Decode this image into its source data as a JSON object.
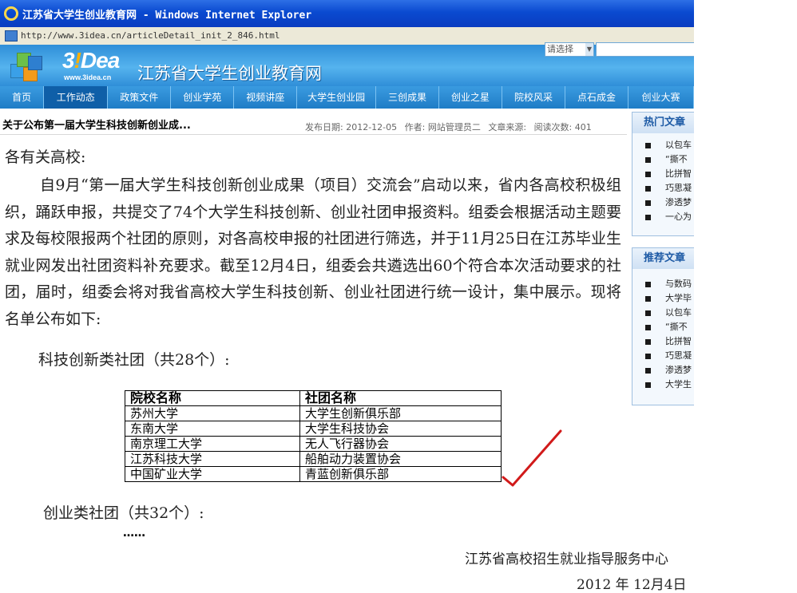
{
  "window": {
    "title": "江苏省大学生创业教育网 - Windows Internet Explorer"
  },
  "address": {
    "url": "http://www.3idea.cn/articleDetail_init_2_846.html"
  },
  "header": {
    "logo_text_a": "3",
    "logo_text_ex": "!",
    "logo_text_b": "Dea",
    "logo_url": "www.3idea.cn",
    "site_name": "江苏省大学生创业教育网",
    "select_label": "请选择"
  },
  "nav": {
    "items": [
      "首页",
      "工作动态",
      "政策文件",
      "创业学苑",
      "视频讲座",
      "大学生创业园",
      "三创成果",
      "创业之星",
      "院校风采",
      "点石成金",
      "创业大赛"
    ],
    "active": "工作动态"
  },
  "article": {
    "title": "关于公布第一届大学生科技创新创业成...",
    "meta_date": "发布日期: 2012-12-05",
    "meta_author": "作者: 网站管理员二",
    "meta_source": "文章来源:",
    "meta_views": "阅读次数: 401",
    "salutation": "各有关高校:",
    "paragraph": "自9月“第一届大学生科技创新创业成果（项目）交流会”启动以来，省内各高校积极组织，踊跃申报，共提交了74个大学生科技创新、创业社团申报资料。组委会根据活动主题要求及每校限报两个社团的原则，对各高校申报的社团进行筛选，并于11月25日在江苏毕业生就业网发出社团资料补充要求。截至12月4日，组委会共遴选出60个符合本次活动要求的社团，届时，组委会将对我省高校大学生科技创新、创业社团进行统一设计，集中展示。现将名单公布如下:",
    "subhead1": "科技创新类社团（共28个）:",
    "table": {
      "headers": [
        "院校名称",
        "社团名称"
      ],
      "rows": [
        [
          "苏州大学",
          "大学生创新俱乐部"
        ],
        [
          "东南大学",
          "大学生科技协会"
        ],
        [
          "南京理工大学",
          "无人飞行器协会"
        ],
        [
          "江苏科技大学",
          "船舶动力装置协会"
        ],
        [
          "中国矿业大学",
          "青蓝创新俱乐部"
        ]
      ]
    },
    "subhead2": "创业类社团（共32个）:",
    "ellipsis": "……",
    "org": "江苏省高校招生就业指导服务中心",
    "date": "2012 年 12月4日"
  },
  "sidebar": {
    "hot_title": "热门文章",
    "hot_items": [
      "以包车",
      "“撕不",
      "比拼智",
      "巧思凝",
      "渗透梦",
      "一心为"
    ],
    "rec_title": "推荐文章",
    "rec_items": [
      "与数码",
      "大学毕",
      "以包车",
      "“撕不",
      "比拼智",
      "巧思凝",
      "渗透梦",
      "大学生"
    ]
  },
  "colors": {
    "nav_blue": "#1f7cc6",
    "title_bar": "#0a4ad0",
    "check_red": "#d11a1a"
  }
}
